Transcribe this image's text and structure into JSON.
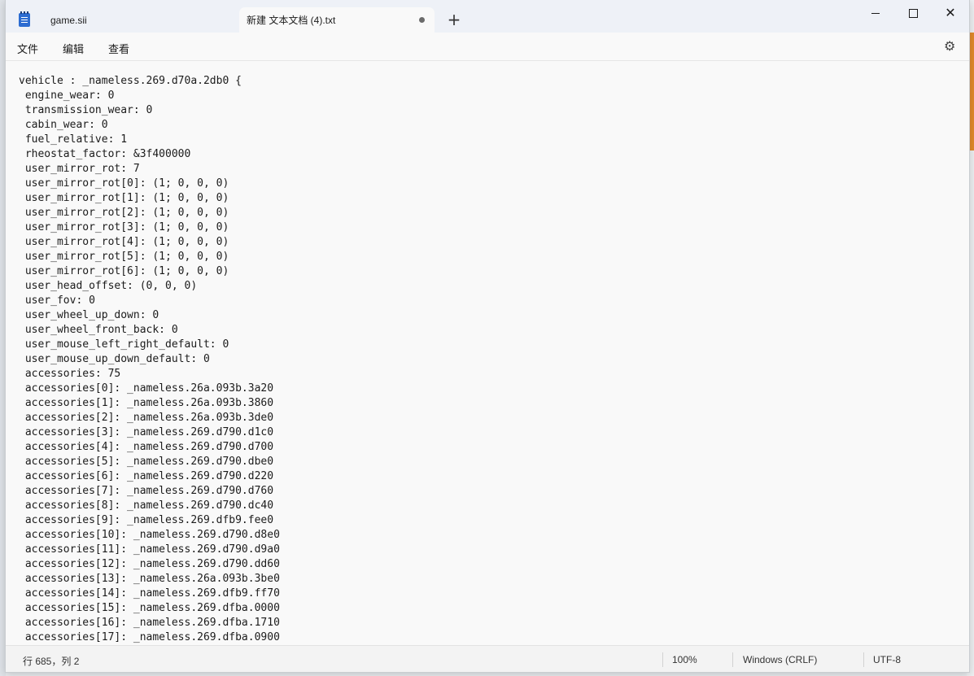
{
  "titlebar": {
    "tabs": [
      {
        "label": "game.sii",
        "active": false
      },
      {
        "label": "新建 文本文档 (4).txt",
        "active": true
      }
    ],
    "new_tab_label": "+",
    "minimize_label": "",
    "maximize_label": "",
    "close_label": "✕"
  },
  "menu": {
    "file": "文件",
    "edit": "编辑",
    "view": "查看",
    "settings_icon": "⚙"
  },
  "editor": {
    "lines": [
      "vehicle : _nameless.269.d70a.2db0 {",
      " engine_wear: 0",
      " transmission_wear: 0",
      " cabin_wear: 0",
      " fuel_relative: 1",
      " rheostat_factor: &3f400000",
      " user_mirror_rot: 7",
      " user_mirror_rot[0]: (1; 0, 0, 0)",
      " user_mirror_rot[1]: (1; 0, 0, 0)",
      " user_mirror_rot[2]: (1; 0, 0, 0)",
      " user_mirror_rot[3]: (1; 0, 0, 0)",
      " user_mirror_rot[4]: (1; 0, 0, 0)",
      " user_mirror_rot[5]: (1; 0, 0, 0)",
      " user_mirror_rot[6]: (1; 0, 0, 0)",
      " user_head_offset: (0, 0, 0)",
      " user_fov: 0",
      " user_wheel_up_down: 0",
      " user_wheel_front_back: 0",
      " user_mouse_left_right_default: 0",
      " user_mouse_up_down_default: 0",
      " accessories: 75",
      " accessories[0]: _nameless.26a.093b.3a20",
      " accessories[1]: _nameless.26a.093b.3860",
      " accessories[2]: _nameless.26a.093b.3de0",
      " accessories[3]: _nameless.269.d790.d1c0",
      " accessories[4]: _nameless.269.d790.d700",
      " accessories[5]: _nameless.269.d790.dbe0",
      " accessories[6]: _nameless.269.d790.d220",
      " accessories[7]: _nameless.269.d790.d760",
      " accessories[8]: _nameless.269.d790.dc40",
      " accessories[9]: _nameless.269.dfb9.fee0",
      " accessories[10]: _nameless.269.d790.d8e0",
      " accessories[11]: _nameless.269.d790.d9a0",
      " accessories[12]: _nameless.269.d790.dd60",
      " accessories[13]: _nameless.26a.093b.3be0",
      " accessories[14]: _nameless.269.dfb9.ff70",
      " accessories[15]: _nameless.269.dfba.0000",
      " accessories[16]: _nameless.269.dfba.1710",
      " accessories[17]: _nameless.269.dfba.0900"
    ]
  },
  "statusbar": {
    "position": "行 685，列 2",
    "zoom": "100%",
    "line_ending": "Windows (CRLF)",
    "encoding": "UTF-8"
  }
}
